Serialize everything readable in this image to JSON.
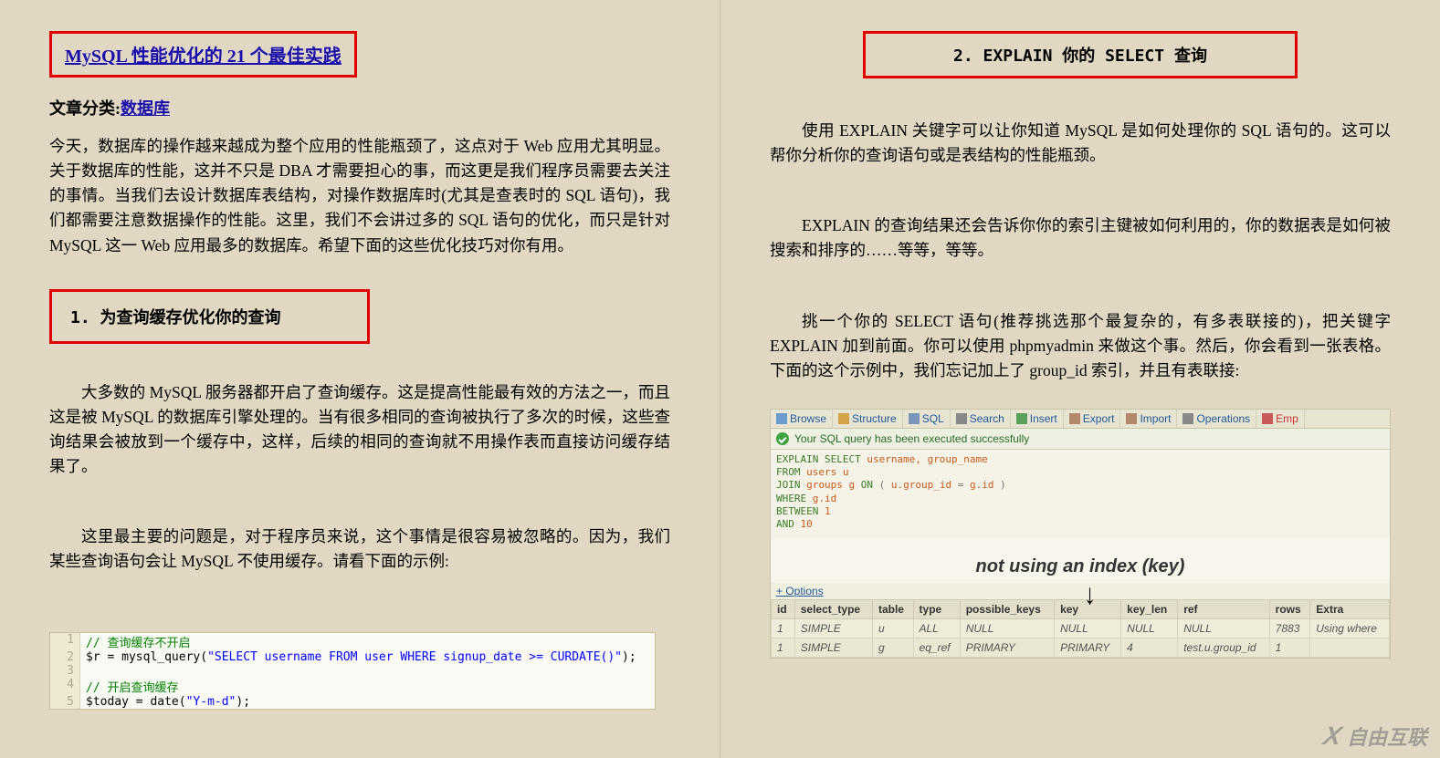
{
  "left": {
    "title": "MySQL 性能优化的 21 个最佳实践",
    "category_label": "文章分类:",
    "category_link": "数据库",
    "intro": "今天，数据库的操作越来越成为整个应用的性能瓶颈了，这点对于 Web 应用尤其明显。关于数据库的性能，这并不只是 DBA 才需要担心的事，而这更是我们程序员需要去关注的事情。当我们去设计数据库表结构，对操作数据库时(尤其是查表时的 SQL 语句)，我们都需要注意数据操作的性能。这里，我们不会讲过多的 SQL 语句的优化，而只是针对 MySQL 这一 Web 应用最多的数据库。希望下面的这些优化技巧对你有用。",
    "h1": "1. 为查询缓存优化你的查询",
    "p1": "大多数的 MySQL 服务器都开启了查询缓存。这是提高性能最有效的方法之一，而且这是被 MySQL 的数据库引擎处理的。当有很多相同的查询被执行了多次的时候，这些查询结果会被放到一个缓存中，这样，后续的相同的查询就不用操作表而直接访问缓存结果了。",
    "p2": "这里最主要的问题是，对于程序员来说，这个事情是很容易被忽略的。因为，我们某些查询语句会让 MySQL 不使用缓存。请看下面的示例:",
    "code": {
      "1": "// 查询缓存不开启",
      "2": "$r = mysql_query(\"SELECT username FROM user WHERE signup_date >= CURDATE()\");",
      "3": "",
      "4": "// 开启查询缓存",
      "5": "$today = date(\"Y-m-d\");"
    }
  },
  "right": {
    "h2": "2. EXPLAIN 你的 SELECT 查询",
    "p1": "使用 EXPLAIN 关键字可以让你知道 MySQL 是如何处理你的 SQL 语句的。这可以帮你分析你的查询语句或是表结构的性能瓶颈。",
    "p2": "EXPLAIN 的查询结果还会告诉你你的索引主键被如何利用的，你的数据表是如何被搜索和排序的……等等，等等。",
    "p3": "挑一个你的 SELECT 语句(推荐挑选那个最复杂的，有多表联接的)，把关键字 EXPLAIN 加到前面。你可以使用 phpmyadmin 来做这个事。然后，你会看到一张表格。下面的这个示例中，我们忘记加上了 group_id 索引，并且有表联接:",
    "pma_tabs": [
      "Browse",
      "Structure",
      "SQL",
      "Search",
      "Insert",
      "Export",
      "Import",
      "Operations",
      "Emp"
    ],
    "success_msg": "Your SQL query has been executed successfully",
    "sql_lines": [
      "EXPLAIN SELECT username, group_name",
      "FROM users u",
      "JOIN groups g ON ( u.group_id = g.id )",
      "WHERE g.id",
      "BETWEEN 1",
      "AND 10"
    ],
    "annotation": "not using an index (key)",
    "options_label": "+ Options",
    "table": {
      "headers": [
        "id",
        "select_type",
        "table",
        "type",
        "possible_keys",
        "key",
        "key_len",
        "ref",
        "rows",
        "Extra"
      ],
      "rows": [
        [
          "1",
          "SIMPLE",
          "u",
          "ALL",
          "NULL",
          "NULL",
          "NULL",
          "NULL",
          "7883",
          "Using where"
        ],
        [
          "1",
          "SIMPLE",
          "g",
          "eq_ref",
          "PRIMARY",
          "PRIMARY",
          "4",
          "test.u.group_id",
          "1",
          ""
        ]
      ]
    }
  },
  "watermark": "自由互联"
}
